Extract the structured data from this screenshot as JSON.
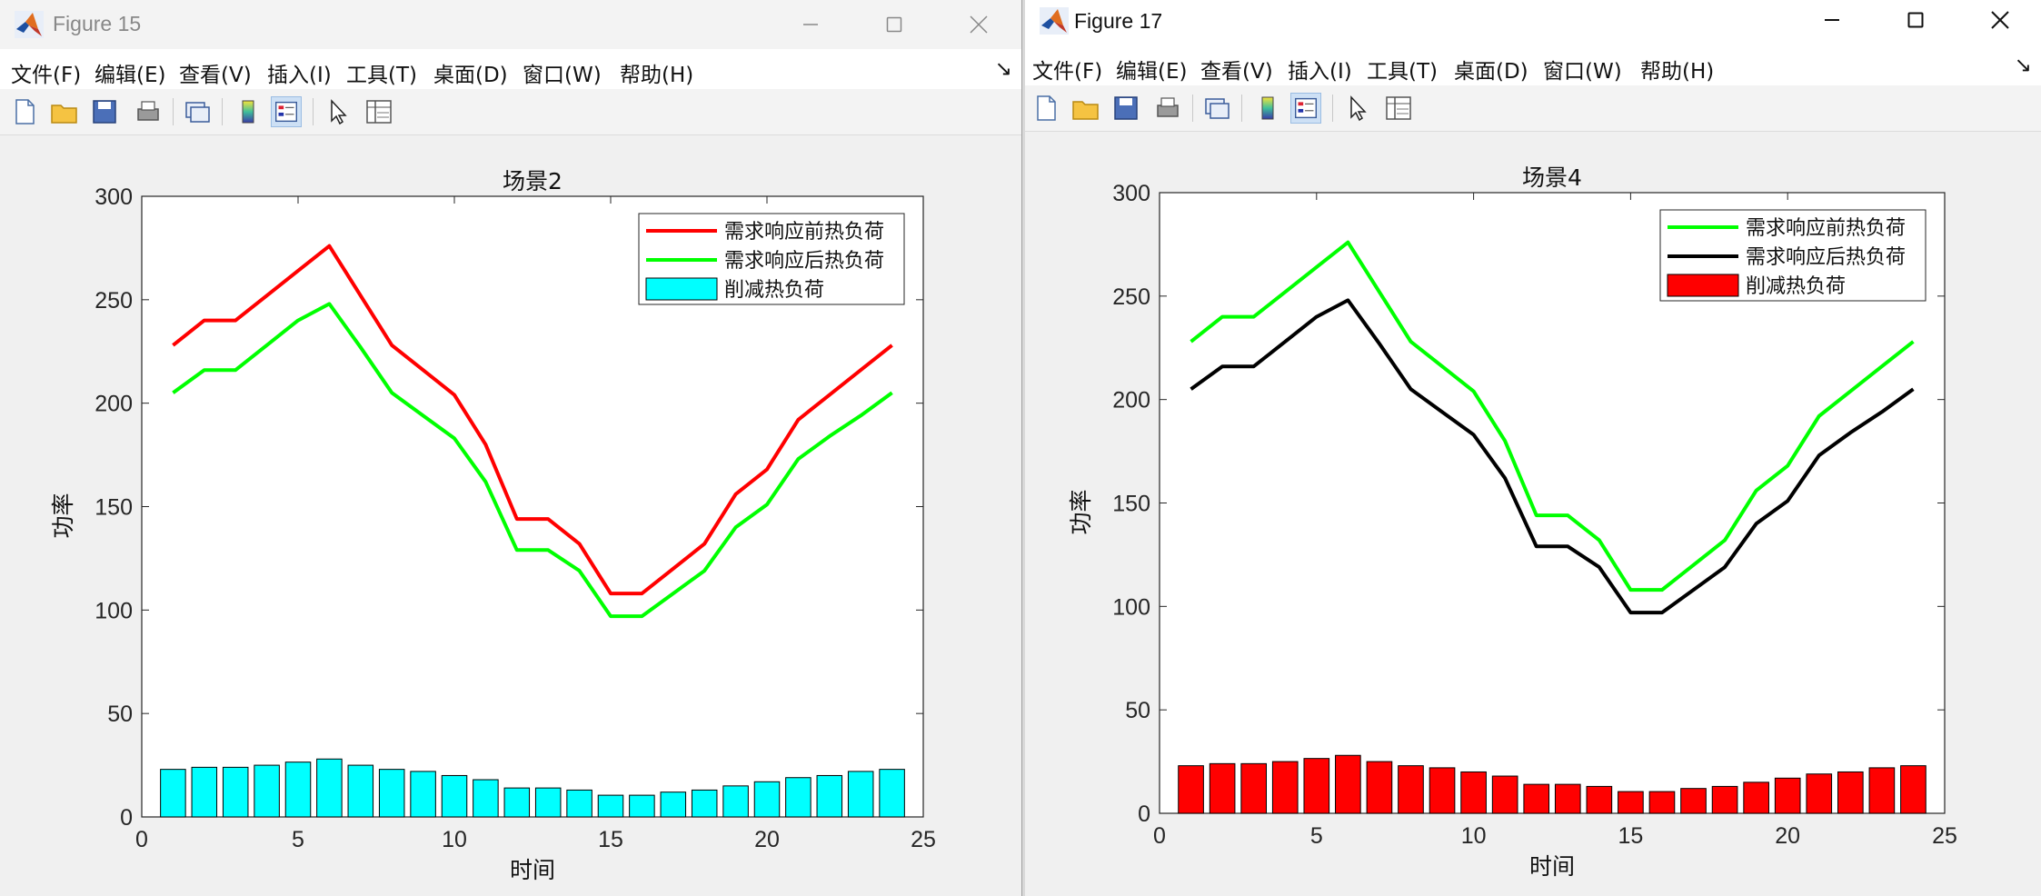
{
  "windows": [
    {
      "title": "Figure 15",
      "menu": [
        "文件(F)",
        "编辑(E)",
        "查看(V)",
        "插入(I)",
        "工具(T)",
        "桌面(D)",
        "窗口(W)",
        "帮助(H)"
      ],
      "chart_data": {
        "type": "line",
        "title": "场景2",
        "xlabel": "时间",
        "ylabel": "功率",
        "xlim": [
          0,
          25
        ],
        "ylim": [
          0,
          300
        ],
        "xticks": [
          0,
          5,
          10,
          15,
          20,
          25
        ],
        "yticks": [
          0,
          50,
          100,
          150,
          200,
          250,
          300
        ],
        "grid": false,
        "legend_position": "top-right",
        "x": [
          1,
          2,
          3,
          4,
          5,
          6,
          7,
          8,
          9,
          10,
          11,
          12,
          13,
          14,
          15,
          16,
          17,
          18,
          19,
          20,
          21,
          22,
          23,
          24
        ],
        "series": [
          {
            "name": "需求响应前热负荷",
            "kind": "line",
            "color": "#ff0000",
            "values": [
              228,
              240,
              240,
              252,
              264,
              276,
              252,
              228,
              216,
              204,
              180,
              144,
              144,
              132,
              108,
              108,
              120,
              132,
              156,
              168,
              192,
              204,
              216,
              228
            ]
          },
          {
            "name": "需求响应后热负荷",
            "kind": "line",
            "color": "#00ff00",
            "values": [
              205,
              216,
              216,
              228,
              240,
              248,
              227,
              205,
              194,
              183,
              162,
              129,
              129,
              119,
              97,
              97,
              108,
              119,
              140,
              151,
              173,
              184,
              194,
              205
            ]
          },
          {
            "name": "削减热负荷",
            "kind": "bar",
            "color": "#00ffff",
            "values": [
              23,
              24,
              24,
              25,
              26.5,
              28,
              25,
              23,
              22,
              20,
              18,
              14,
              14,
              13,
              10.5,
              10.5,
              12,
              13,
              15,
              17,
              19,
              20,
              22,
              23
            ]
          }
        ]
      }
    },
    {
      "title": "Figure 17",
      "menu": [
        "文件(F)",
        "编辑(E)",
        "查看(V)",
        "插入(I)",
        "工具(T)",
        "桌面(D)",
        "窗口(W)",
        "帮助(H)"
      ],
      "chart_data": {
        "type": "line",
        "title": "场景4",
        "xlabel": "时间",
        "ylabel": "功率",
        "xlim": [
          0,
          25
        ],
        "ylim": [
          0,
          300
        ],
        "xticks": [
          0,
          5,
          10,
          15,
          20,
          25
        ],
        "yticks": [
          0,
          50,
          100,
          150,
          200,
          250,
          300
        ],
        "grid": false,
        "legend_position": "top-right",
        "x": [
          1,
          2,
          3,
          4,
          5,
          6,
          7,
          8,
          9,
          10,
          11,
          12,
          13,
          14,
          15,
          16,
          17,
          18,
          19,
          20,
          21,
          22,
          23,
          24
        ],
        "series": [
          {
            "name": "需求响应前热负荷",
            "kind": "line",
            "color": "#00ff00",
            "values": [
              228,
              240,
              240,
              252,
              264,
              276,
              252,
              228,
              216,
              204,
              180,
              144,
              144,
              132,
              108,
              108,
              120,
              132,
              156,
              168,
              192,
              204,
              216,
              228
            ]
          },
          {
            "name": "需求响应后热负荷",
            "kind": "line",
            "color": "#000000",
            "values": [
              205,
              216,
              216,
              228,
              240,
              248,
              227,
              205,
              194,
              183,
              162,
              129,
              129,
              119,
              97,
              97,
              108,
              119,
              140,
              151,
              173,
              184,
              194,
              205
            ]
          },
          {
            "name": "削减热负荷",
            "kind": "bar",
            "color": "#ff0000",
            "values": [
              23,
              24,
              24,
              25,
              26.5,
              28,
              25,
              23,
              22,
              20,
              18,
              14,
              14,
              13,
              10.5,
              10.5,
              12,
              13,
              15,
              17,
              19,
              20,
              22,
              23
            ]
          }
        ]
      }
    }
  ]
}
